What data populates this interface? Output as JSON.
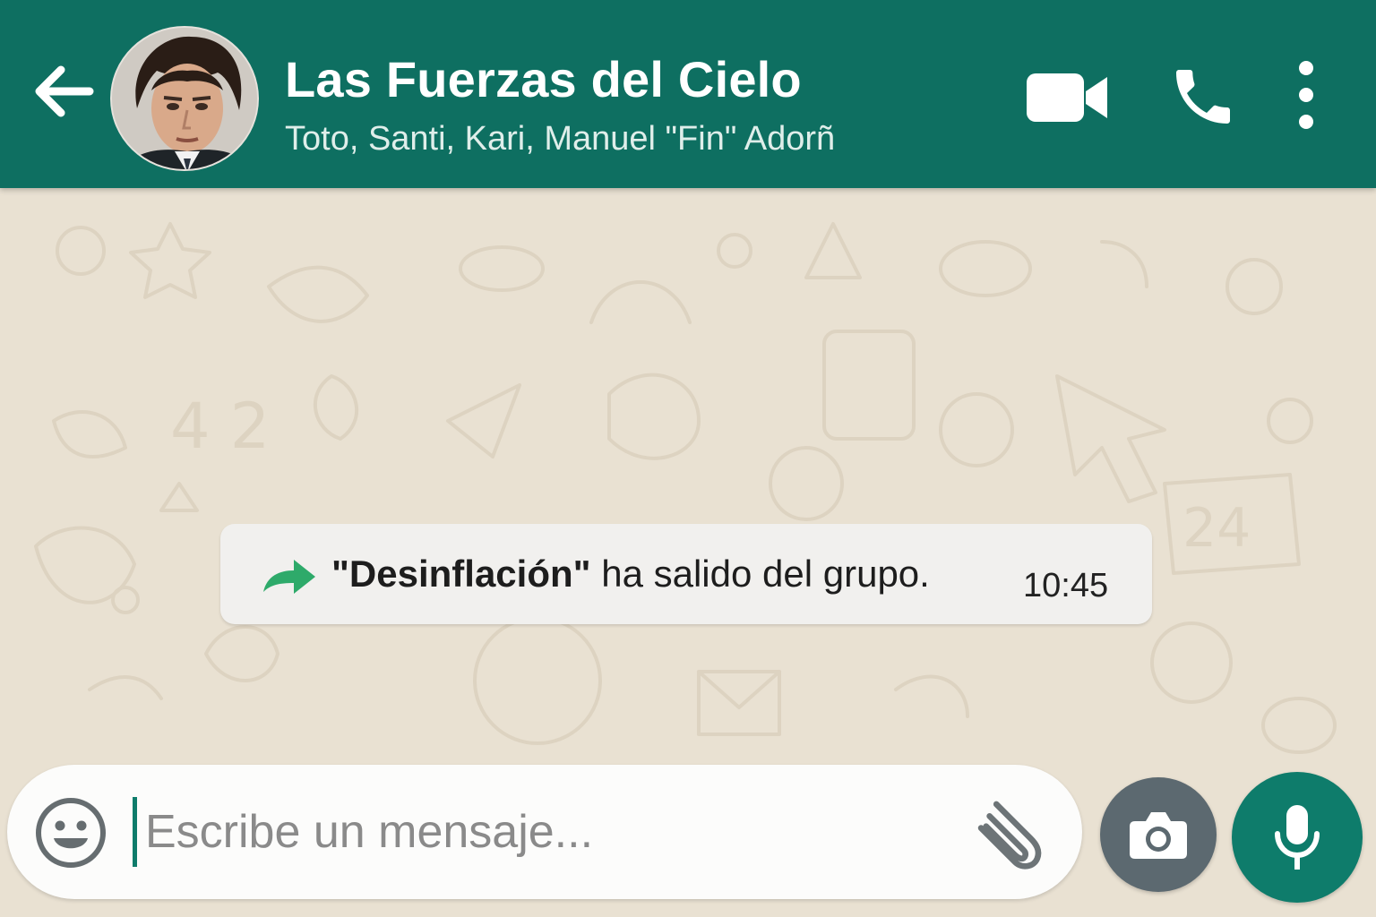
{
  "header": {
    "title": "Las Fuerzas del Cielo",
    "subtitle": "Toto, Santi, Kari, Manuel \"Fin\" Adorñ",
    "back_icon": "arrow-left-icon",
    "video_icon": "video-camera-icon",
    "call_icon": "phone-icon",
    "menu_icon": "more-vertical-icon",
    "background_color": "#0e6f61"
  },
  "chat": {
    "background_color": "#e9e1d2",
    "system_message": {
      "icon": "forward-arrow-icon",
      "name": "\"Desinflación\"",
      "text": " ha salido del grupo.",
      "time": "10:45"
    }
  },
  "composer": {
    "placeholder": "Escribe un mensaje...",
    "value": "",
    "emoji_icon": "smiley-icon",
    "attach_icon": "paperclip-icon",
    "camera_icon": "camera-icon",
    "mic_icon": "microphone-icon",
    "accent_color": "#0e7c6b"
  }
}
